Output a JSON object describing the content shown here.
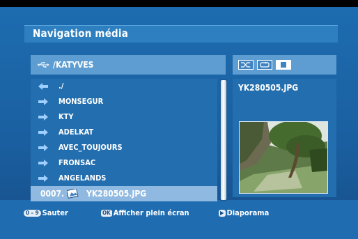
{
  "header": {
    "title": "Navigation média"
  },
  "browser": {
    "path": "/KATYVES",
    "items": [
      {
        "label": "./",
        "type": "parent"
      },
      {
        "label": "MONSEGUR",
        "type": "folder"
      },
      {
        "label": "KTY",
        "type": "folder"
      },
      {
        "label": "ADELKAT",
        "type": "folder"
      },
      {
        "label": "AVEC_TOUJOURS",
        "type": "folder"
      },
      {
        "label": "FRONSAC",
        "type": "folder"
      },
      {
        "label": "ANGELANDS",
        "type": "folder"
      }
    ],
    "selected": {
      "index": "0007.",
      "filename": "YK280505.JPG"
    }
  },
  "preview": {
    "filename": "YK280505.JPG",
    "controls": [
      "shuffle-icon",
      "repeat-icon",
      "stop-icon"
    ]
  },
  "footer": {
    "skip_keys": "0 – 9",
    "skip_label": "Sauter",
    "ok_key": "OK",
    "fullscreen_label": "Afficher plein écran",
    "play_key": "▶",
    "slideshow_label": "Diaporama"
  },
  "colors": {
    "background": "#1a5fa0",
    "panel": "#236eae",
    "header": "#5e9dd1",
    "selection": "#8fb9e0",
    "arrow": "#9fd0ff"
  }
}
